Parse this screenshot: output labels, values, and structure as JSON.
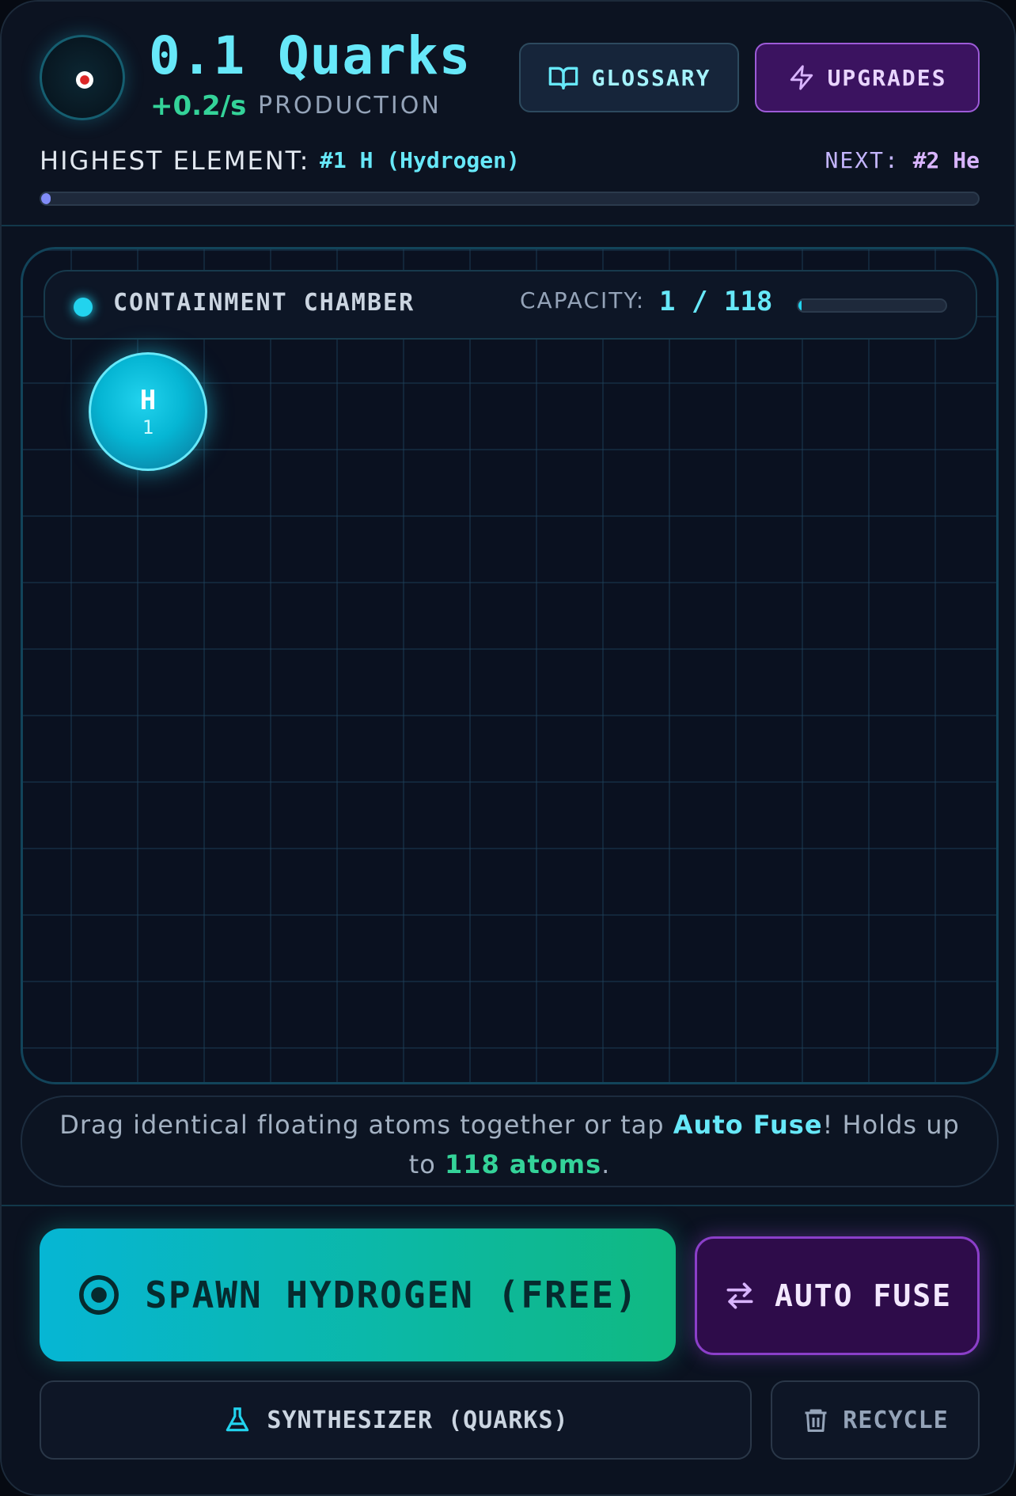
{
  "header": {
    "quarks_display": "0.1 Quarks",
    "rate": "+0.2/s",
    "production_label": "PRODUCTION",
    "buttons": {
      "glossary": {
        "label": "GLOSSARY",
        "icon": "book-open-icon"
      },
      "upgrades": {
        "label": "UPGRADES",
        "icon": "lightning-icon"
      }
    },
    "highest_element_label": "HIGHEST ELEMENT:",
    "highest_element_value": "#1 H (Hydrogen)",
    "next_label": "NEXT:",
    "next_value": "#2 He",
    "progress_fraction": 0.01
  },
  "chamber": {
    "title": "CONTAINMENT CHAMBER",
    "capacity_label": "CAPACITY:",
    "capacity_value": "1 / 118",
    "capacity_used": 1,
    "capacity_max": 118,
    "atoms": [
      {
        "symbol": "H",
        "number": "1"
      }
    ]
  },
  "hint": {
    "part1": "Drag identical floating atoms together or tap ",
    "highlight1": "Auto Fuse",
    "part2": "! Holds up to ",
    "highlight2": "118 atoms",
    "part3": "."
  },
  "actions": {
    "spawn": {
      "label": "SPAWN HYDROGEN (FREE)",
      "icon": "target-icon"
    },
    "auto_fuse": {
      "label": "AUTO FUSE",
      "icon": "swap-arrows-icon"
    },
    "synthesizer": {
      "label": "SYNTHESIZER (QUARKS)",
      "icon": "flask-icon"
    },
    "recycle": {
      "label": "RECYCLE",
      "icon": "trash-icon"
    }
  },
  "colors": {
    "accent_cyan": "#22d3ee",
    "accent_green": "#34d399",
    "accent_purple": "#a855f7",
    "background": "#0b1220"
  }
}
